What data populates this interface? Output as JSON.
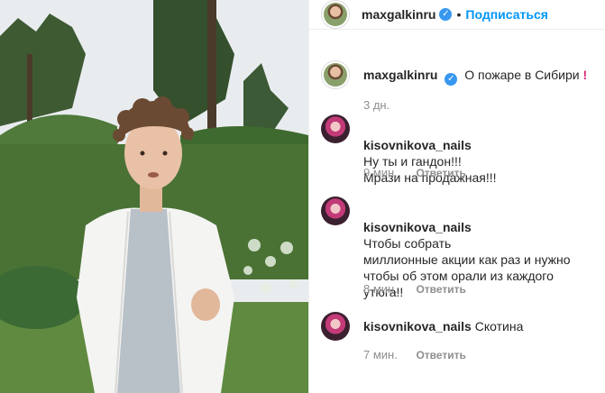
{
  "header": {
    "username": "maxgalkinru",
    "separator": "•",
    "follow_label": "Подписаться"
  },
  "caption": {
    "username": "maxgalkinru",
    "text": "О пожаре в Сибири",
    "emphasis": "!",
    "time": "3 дн."
  },
  "comments": [
    {
      "username": "kisovnikova_nails",
      "text": "Ну ты и гандон!!!\nМрази на продажная!!!",
      "time": "9 мин.",
      "reply": "Ответить"
    },
    {
      "username": "kisovnikova_nails",
      "text": "Чтобы собрать\nмиллионные акции как раз и нужно\nчтобы об этом орали из каждого\nутюга!!",
      "time": "8 мин.",
      "reply": "Ответить"
    },
    {
      "username": "kisovnikova_nails",
      "text": "Скотина",
      "time": "7 мин.",
      "reply": "Ответить"
    }
  ],
  "icons": {
    "verified": "verified-badge-icon"
  },
  "colors": {
    "link": "#0095f6",
    "muted": "#8e8e8e",
    "verified": "#3897f0"
  }
}
